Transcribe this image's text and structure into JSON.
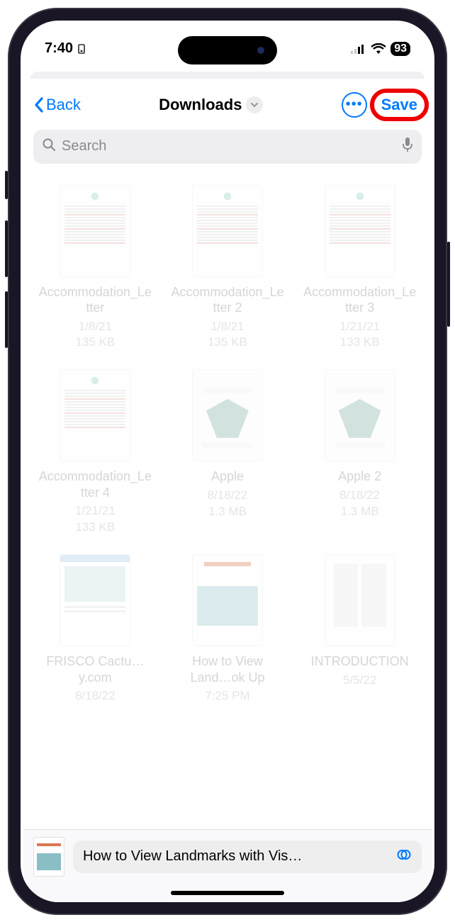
{
  "status": {
    "time": "7:40",
    "battery_pct": "93"
  },
  "nav": {
    "back_label": "Back",
    "title": "Downloads",
    "save_label": "Save"
  },
  "search": {
    "placeholder": "Search"
  },
  "files": [
    {
      "name": "Accommodation_Letter",
      "date": "1/8/21",
      "size": "135 KB",
      "thumb": "doc"
    },
    {
      "name": "Accommodation_Letter 2",
      "date": "1/8/21",
      "size": "135 KB",
      "thumb": "doc"
    },
    {
      "name": "Accommodation_Letter 3",
      "date": "1/21/21",
      "size": "133 KB",
      "thumb": "doc"
    },
    {
      "name": "Accommodation_Letter 4",
      "date": "1/21/21",
      "size": "133 KB",
      "thumb": "doc"
    },
    {
      "name": "Apple",
      "date": "8/18/22",
      "size": "1.3 MB",
      "thumb": "apple"
    },
    {
      "name": "Apple 2",
      "date": "8/18/22",
      "size": "1.3 MB",
      "thumb": "apple"
    },
    {
      "name": "FRISCO Cactu…y.com",
      "date": "8/18/22",
      "size": "",
      "thumb": "web"
    },
    {
      "name": "How to View Land…ok Up",
      "date": "7:25 PM",
      "size": "",
      "thumb": "howto"
    },
    {
      "name": "INTRODUCTION",
      "date": "5/5/22",
      "size": "",
      "thumb": "intro"
    }
  ],
  "bottom": {
    "current_file": "How to View Landmarks with Vis…"
  }
}
